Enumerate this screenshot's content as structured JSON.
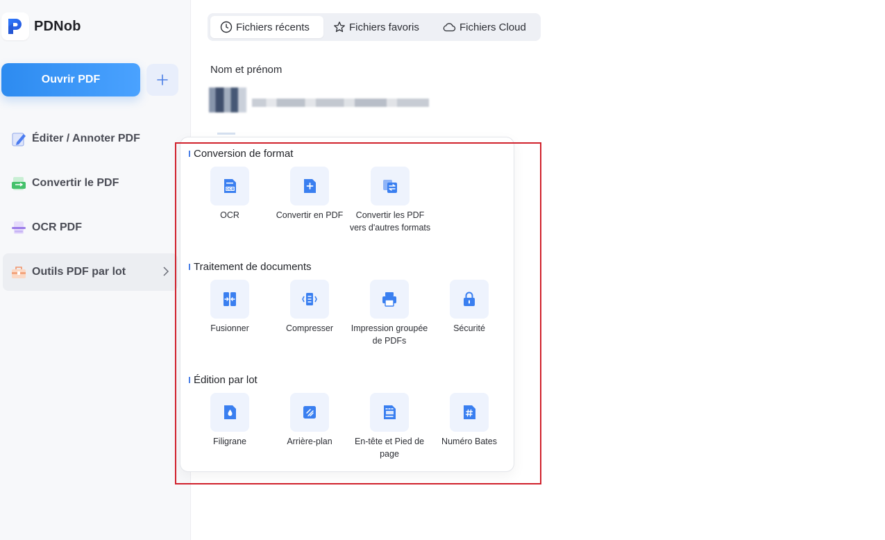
{
  "app": {
    "name": "PDNob"
  },
  "sidebar": {
    "open_button": "Ouvrir PDF",
    "items": [
      {
        "label": "Éditer / Annoter PDF"
      },
      {
        "label": "Convertir le PDF"
      },
      {
        "label": "OCR PDF"
      },
      {
        "label": "Outils PDF par lot"
      }
    ]
  },
  "tabs": [
    {
      "label": "Fichiers récents"
    },
    {
      "label": "Fichiers favoris"
    },
    {
      "label": "Fichiers Cloud"
    }
  ],
  "file_list": {
    "column_header": "Nom et prénom"
  },
  "batch_menu": {
    "sections": [
      {
        "title": "Conversion de format",
        "tools": [
          "OCR",
          "Convertir en PDF",
          "Convertir les PDF vers d'autres formats"
        ]
      },
      {
        "title": "Traitement de documents",
        "tools": [
          "Fusionner",
          "Compresser",
          "Impression groupée de PDFs",
          "Sécurité"
        ]
      },
      {
        "title": "Édition par lot",
        "tools": [
          "Filigrane",
          "Arrière-plan",
          "En-tête et Pied de page",
          "Numéro Bates"
        ]
      }
    ]
  },
  "colors": {
    "accent": "#3a8ff5",
    "highlight_border": "#d0202b",
    "tool_icon": "#3a7ff0"
  },
  "icons": {
    "tools": [
      "ocr-icon",
      "convert-to-pdf-icon",
      "convert-pdf-to-formats-icon",
      "merge-icon",
      "compress-icon",
      "print-icon",
      "lock-icon",
      "watermark-icon",
      "background-icon",
      "header-footer-icon",
      "bates-number-icon"
    ]
  }
}
